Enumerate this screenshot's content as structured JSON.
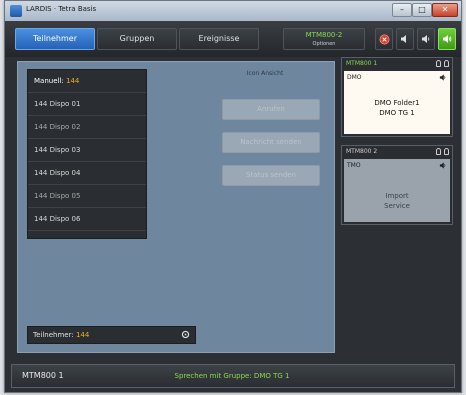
{
  "window": {
    "title": "LARDIS · Tetra Basis",
    "min_glyph": "–",
    "max_glyph": "□",
    "close_glyph": "✕"
  },
  "nav": {
    "tabs": [
      {
        "label": "Teilnehmer",
        "active": true
      },
      {
        "label": "Gruppen",
        "active": false
      },
      {
        "label": "Ereignisse",
        "active": false
      }
    ],
    "device": {
      "name": "MTM800-2",
      "sub": "Optionen"
    }
  },
  "list": {
    "items": [
      {
        "prefix": "Manuell:",
        "value": "144"
      },
      {
        "label": "144 Dispo 01"
      },
      {
        "label": "144 Dispo 02"
      },
      {
        "label": "144 Dispo 03"
      },
      {
        "label": "144 Dispo 04"
      },
      {
        "label": "144 Dispo 05"
      },
      {
        "label": "144 Dispo 06"
      }
    ]
  },
  "actions": {
    "view_label": "Icon Ansicht",
    "buttons": [
      "Anrufen",
      "Nachricht senden",
      "Status senden"
    ]
  },
  "counter": {
    "label": "Teilnehmer:",
    "value": "144"
  },
  "cards": [
    {
      "title": "MTM800 1",
      "mode": "DMO",
      "line1": "DMO Folder1",
      "line2": "DMO TG 1",
      "active": true
    },
    {
      "title": "MTM800 2",
      "mode": "TMO",
      "line1": "Import",
      "line2": "Service",
      "active": false
    }
  ],
  "status": {
    "device": "MTM800 1",
    "message": "Sprechen mit Gruppe: DMO TG 1"
  },
  "colors": {
    "accent_blue": "#3a7fd8",
    "accent_green": "#8bd84e",
    "highlight_orange": "#f0b020",
    "panel_blue": "#6f879e"
  }
}
